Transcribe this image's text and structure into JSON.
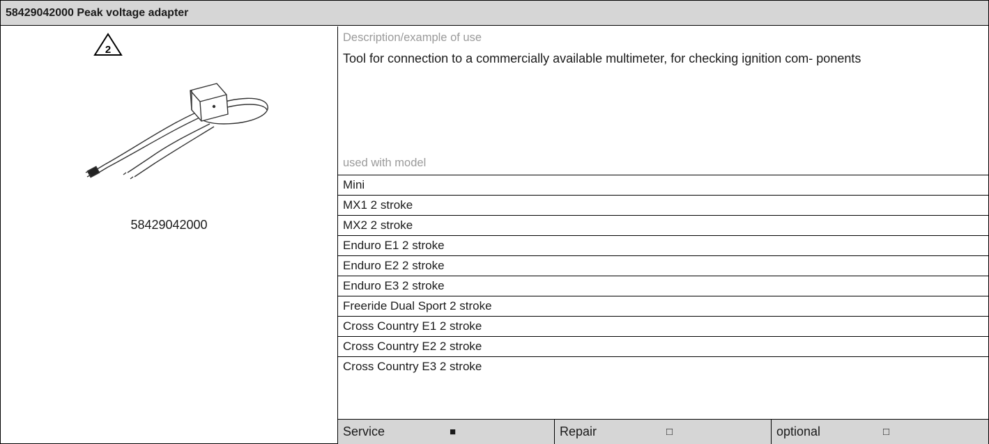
{
  "title": "58429042000 Peak voltage adapter",
  "warning_number": "2",
  "part_number": "58429042000",
  "description_label": "Description/example of use",
  "description_text": "Tool for connection to a commercially available multimeter, for checking ignition com- ponents",
  "models_label": "used with model",
  "models": [
    "Mini",
    "MX1 2 stroke",
    "MX2 2 stroke",
    "Enduro E1 2 stroke",
    "Enduro E2 2 stroke",
    "Enduro E3 2 stroke",
    "Freeride Dual Sport 2 stroke",
    "Cross Country E1 2 stroke",
    "Cross Country E2 2 stroke",
    "Cross Country E3 2 stroke"
  ],
  "categories": [
    {
      "label": "Service",
      "mark": "■"
    },
    {
      "label": "Repair",
      "mark": "□"
    },
    {
      "label": "optional",
      "mark": "□"
    }
  ]
}
